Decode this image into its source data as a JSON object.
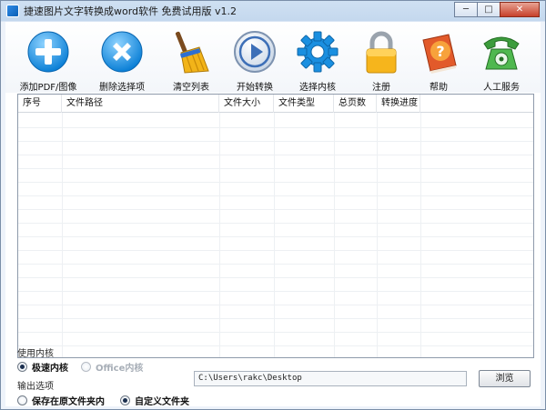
{
  "window": {
    "title": "捷速图片文字转换成word软件 免费试用版 v1.2",
    "controls": {
      "minimize": "─",
      "maximize": "□",
      "close": "✕"
    }
  },
  "toolbar": [
    {
      "label": "添加PDF/图像",
      "icon": "add-icon"
    },
    {
      "label": "删除选择项",
      "icon": "delete-icon"
    },
    {
      "label": "清空列表",
      "icon": "broom-icon"
    },
    {
      "label": "开始转换",
      "icon": "play-icon"
    },
    {
      "label": "选择内核",
      "icon": "gear-icon"
    },
    {
      "label": "注册",
      "icon": "lock-icon"
    },
    {
      "label": "帮助",
      "icon": "help-book-icon"
    },
    {
      "label": "人工服务",
      "icon": "phone-icon"
    }
  ],
  "table": {
    "columns": [
      "序号",
      "文件路径",
      "文件大小",
      "文件类型",
      "总页数",
      "转换进度"
    ],
    "rows": []
  },
  "engine": {
    "title": "使用内核",
    "options": [
      {
        "label": "极速内核",
        "checked": true,
        "disabled": false
      },
      {
        "label": "Office内核",
        "checked": false,
        "disabled": true
      }
    ]
  },
  "output": {
    "title": "输出选项",
    "options": [
      {
        "label": "保存在原文件夹内",
        "checked": false
      },
      {
        "label": "自定义文件夹",
        "checked": true
      }
    ],
    "path_value": "C:\\Users\\rakc\\Desktop",
    "browse_label": "浏览"
  }
}
